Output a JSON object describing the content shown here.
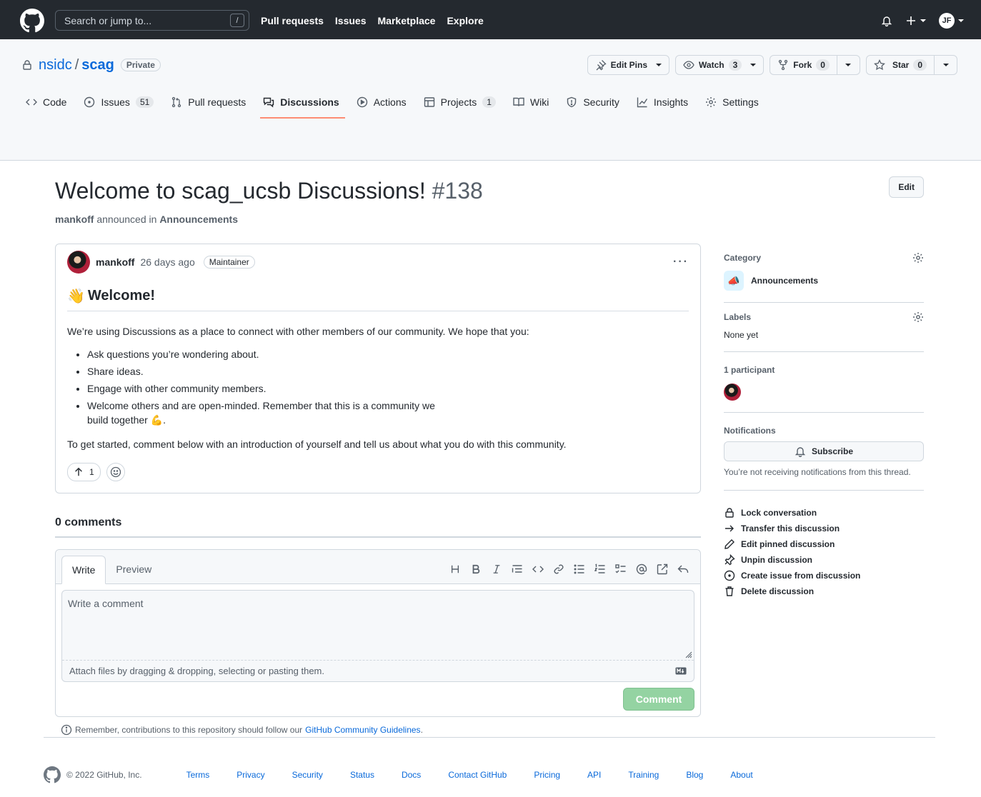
{
  "header": {
    "search_placeholder": "Search or jump to...",
    "search_shortcut": "/",
    "nav": [
      "Pull requests",
      "Issues",
      "Marketplace",
      "Explore"
    ],
    "avatar_initials": "JF"
  },
  "repo": {
    "owner": "nsidc",
    "separator": "/",
    "name": "scag",
    "visibility": "Private",
    "edit_pins": "Edit Pins",
    "watch": "Watch",
    "watch_count": "3",
    "fork": "Fork",
    "fork_count": "0",
    "star": "Star",
    "star_count": "0"
  },
  "tabs": {
    "code": "Code",
    "issues": "Issues",
    "issues_count": "51",
    "pulls": "Pull requests",
    "discussions": "Discussions",
    "actions": "Actions",
    "projects": "Projects",
    "projects_count": "1",
    "wiki": "Wiki",
    "security": "Security",
    "insights": "Insights",
    "settings": "Settings"
  },
  "discussion": {
    "title": "Welcome to scag_ucsb Discussions!",
    "number": "#138",
    "edit": "Edit",
    "author": "mankoff",
    "announced_in": "announced in",
    "category_link": "Announcements",
    "time": "26 days ago",
    "role": "Maintainer",
    "heading_emoji": "👋",
    "heading": "Welcome!",
    "intro": "We’re using Discussions as a place to connect with other members of our community. We hope that you:",
    "bullets": [
      "Ask questions you’re wondering about.",
      "Share ideas.",
      "Engage with other community members.",
      "Welcome others and are open-minded. Remember that this is a community we build together 💪."
    ],
    "bullet4_a": "Welcome others and are open-minded. Remember that this is a community we",
    "bullet4_b": "build together ",
    "bullet4_emoji": "💪",
    "bullet4_end": ".",
    "outro": "To get started, comment below with an introduction of yourself and tell us about what you do with this community.",
    "upvotes": "1"
  },
  "comments": {
    "heading": "0 comments",
    "tab_write": "Write",
    "tab_preview": "Preview",
    "placeholder": "Write a comment",
    "attach": "Attach files by dragging & dropping, selecting or pasting them.",
    "submit": "Comment",
    "guidelines_prefix": "Remember, contributions to this repository should follow our",
    "guidelines_link": "GitHub Community Guidelines",
    "guidelines_suffix": "."
  },
  "sidebar": {
    "category_label": "Category",
    "category_emoji": "📣",
    "category_name": "Announcements",
    "labels_label": "Labels",
    "labels_value": "None yet",
    "participants_label": "1 participant",
    "notifications_label": "Notifications",
    "subscribe": "Subscribe",
    "notif_note": "You’re not receiving notifications from this thread.",
    "actions": [
      "Lock conversation",
      "Transfer this discussion",
      "Edit pinned discussion",
      "Unpin discussion",
      "Create issue from discussion",
      "Delete discussion"
    ]
  },
  "footer": {
    "copyright": "© 2022 GitHub, Inc.",
    "links": [
      "Terms",
      "Privacy",
      "Security",
      "Status",
      "Docs",
      "Contact GitHub",
      "Pricing",
      "API",
      "Training",
      "Blog",
      "About"
    ]
  },
  "colors": {
    "header_bg": "#24292f",
    "link": "#0969da",
    "selected_tab_underline": "#fd8c73",
    "comment_button": "#94d3a2"
  }
}
